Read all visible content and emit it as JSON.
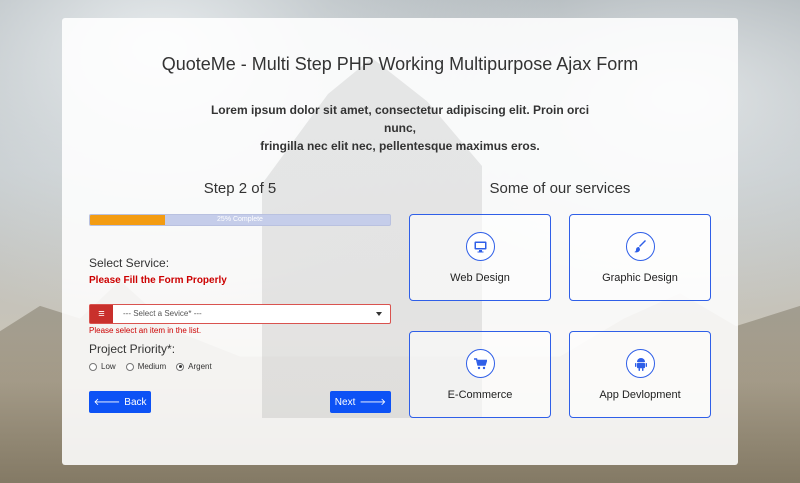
{
  "header": {
    "title": "QuoteMe - Multi Step PHP Working Multipurpose Ajax Form",
    "subtitle_line1": "Lorem ipsum dolor sit amet, consectetur adipiscing elit. Proin orci nunc,",
    "subtitle_line2": "fringilla nec elit nec, pellentesque maximus eros."
  },
  "form": {
    "step_title": "Step 2 of 5",
    "progress": {
      "percent": 25,
      "label": "25% Complete",
      "fill_color": "#f39c12",
      "track_color": "#c5cdea"
    },
    "service_label": "Select Service:",
    "form_error": "Please Fill the Form Properly",
    "service_select": {
      "value": "--- Select a Sevice* ---",
      "error": "Please select an item in the list."
    },
    "priority_label": "Project Priority*:",
    "priority_options": [
      {
        "label": "Low",
        "checked": false
      },
      {
        "label": "Medium",
        "checked": false
      },
      {
        "label": "Argent",
        "checked": true
      }
    ],
    "back_label": "Back",
    "next_label": "Next"
  },
  "services": {
    "title": "Some of our services",
    "items": [
      {
        "label": "Web Design",
        "icon": "monitor-icon"
      },
      {
        "label": "Graphic Design",
        "icon": "paintbrush-icon"
      },
      {
        "label": "E-Commerce",
        "icon": "shopping-cart-icon"
      },
      {
        "label": "App Devlopment",
        "icon": "android-icon"
      }
    ]
  },
  "colors": {
    "accent": "#0d52f5",
    "card_border": "#2f5fe8",
    "error": "#cc0000"
  }
}
